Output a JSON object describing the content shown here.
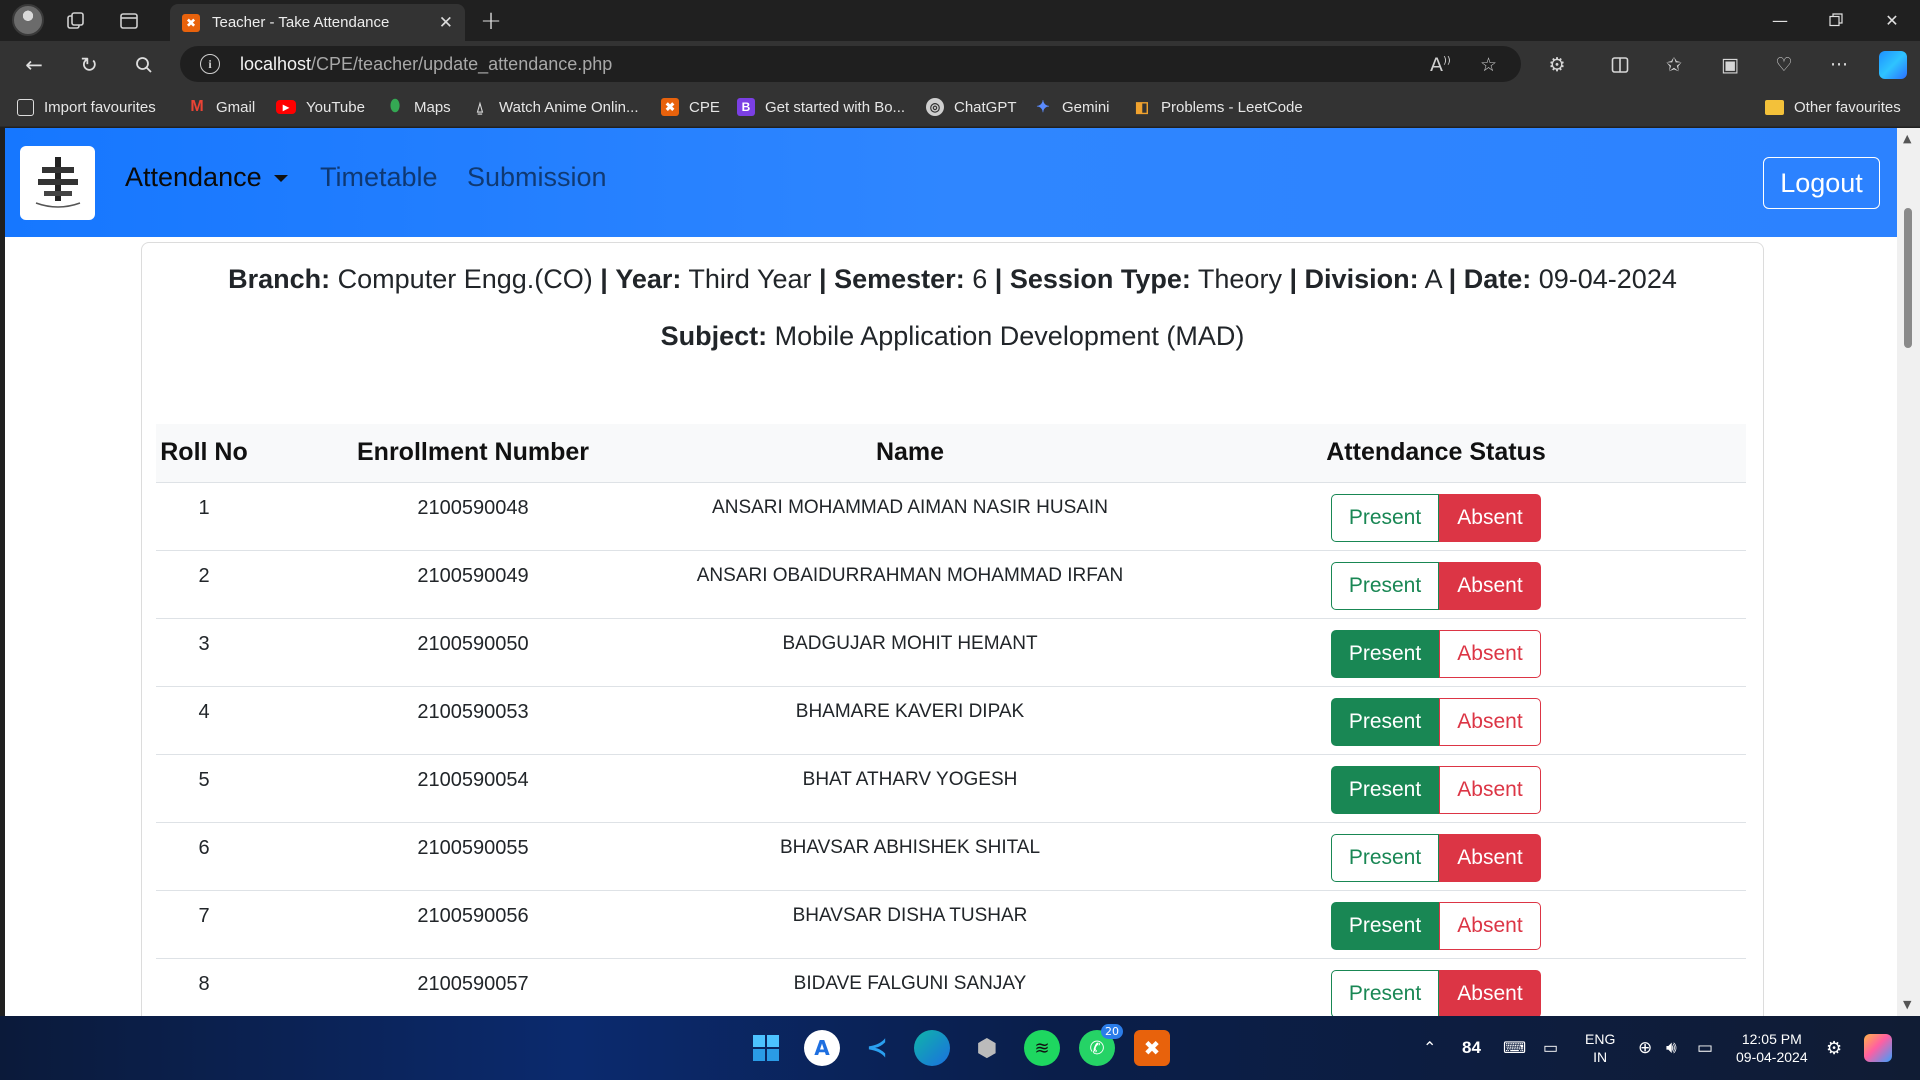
{
  "browser": {
    "tab_title": "Teacher - Take Attendance",
    "url_host": "localhost",
    "url_path": "/CPE/teacher/update_attendance.php",
    "favourites": [
      {
        "label": "Import favourites",
        "icon": "import-icon"
      },
      {
        "label": "Gmail",
        "icon": "gmail-icon"
      },
      {
        "label": "YouTube",
        "icon": "youtube-icon"
      },
      {
        "label": "Maps",
        "icon": "maps-icon"
      },
      {
        "label": "Watch Anime Onlin...",
        "icon": "anime-icon"
      },
      {
        "label": "CPE",
        "icon": "xampp-icon"
      },
      {
        "label": "Get started with Bo...",
        "icon": "bootstrap-icon"
      },
      {
        "label": "ChatGPT",
        "icon": "chatgpt-icon"
      },
      {
        "label": "Gemini",
        "icon": "gemini-icon"
      },
      {
        "label": "Problems - LeetCode",
        "icon": "leetcode-icon"
      }
    ],
    "other_favourites": "Other favourites"
  },
  "nav": {
    "attendance": "Attendance",
    "timetable": "Timetable",
    "submission": "Submission",
    "logout": "Logout"
  },
  "info": {
    "branch_label": "Branch:",
    "branch_value": "Computer Engg.(CO)",
    "year_label": "Year:",
    "year_value": "Third Year",
    "semester_label": "Semester:",
    "semester_value": "6",
    "session_label": "Session Type:",
    "session_value": "Theory",
    "division_label": "Division:",
    "division_value": "A",
    "date_label": "Date:",
    "date_value": "09-04-2024",
    "subject_label": "Subject:",
    "subject_value": "Mobile Application Development (MAD)",
    "separator": "|"
  },
  "table": {
    "headers": [
      "Roll No",
      "Enrollment Number",
      "Name",
      "Attendance Status"
    ],
    "present_label": "Present",
    "absent_label": "Absent",
    "rows": [
      {
        "roll": "1",
        "enrollment": "2100590048",
        "name": "ANSARI MOHAMMAD AIMAN NASIR HUSAIN",
        "status": "Absent"
      },
      {
        "roll": "2",
        "enrollment": "2100590049",
        "name": "ANSARI OBAIDURRAHMAN MOHAMMAD IRFAN",
        "status": "Absent"
      },
      {
        "roll": "3",
        "enrollment": "2100590050",
        "name": "BADGUJAR MOHIT HEMANT",
        "status": "Present"
      },
      {
        "roll": "4",
        "enrollment": "2100590053",
        "name": "BHAMARE KAVERI DIPAK",
        "status": "Present"
      },
      {
        "roll": "5",
        "enrollment": "2100590054",
        "name": "BHAT ATHARV YOGESH",
        "status": "Present"
      },
      {
        "roll": "6",
        "enrollment": "2100590055",
        "name": "BHAVSAR ABHISHEK SHITAL",
        "status": "Absent"
      },
      {
        "roll": "7",
        "enrollment": "2100590056",
        "name": "BHAVSAR DISHA TUSHAR",
        "status": "Present"
      },
      {
        "roll": "8",
        "enrollment": "2100590057",
        "name": "BIDAVE FALGUNI SANJAY",
        "status": "Absent"
      }
    ]
  },
  "taskbar": {
    "weather_temp": "84",
    "lang_line1": "ENG",
    "lang_line2": "IN",
    "time": "12:05 PM",
    "date": "09-04-2024",
    "whatsapp_badge": "20"
  },
  "colors": {
    "navbar": "#1677ff",
    "success": "#198754",
    "danger": "#dc3545"
  }
}
